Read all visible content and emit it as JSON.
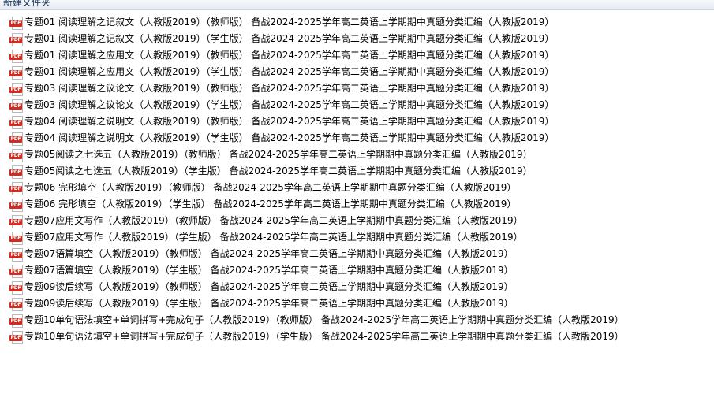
{
  "header": {
    "label": "新建文件夹"
  },
  "icon": {
    "type": "pdf-icon",
    "text": "PDF",
    "color": "#d42a20"
  },
  "files": [
    "专题01 阅读理解之记叙文（人教版2019）（教师版） 备战2024-2025学年高二英语上学期期中真题分类汇编（人教版2019）",
    "专题01 阅读理解之记叙文（人教版2019）（学生版） 备战2024-2025学年高二英语上学期期中真题分类汇编（人教版2019）",
    "专题01 阅读理解之应用文（人教版2019）（教师版） 备战2024-2025学年高二英语上学期期中真题分类汇编（人教版2019）",
    "专题01 阅读理解之应用文（人教版2019）（学生版） 备战2024-2025学年高二英语上学期期中真题分类汇编（人教版2019）",
    "专题03 阅读理解之议论文（人教版2019）（教师版） 备战2024-2025学年高二英语上学期期中真题分类汇编（人教版2019）",
    "专题03 阅读理解之议论文（人教版2019）（学生版） 备战2024-2025学年高二英语上学期期中真题分类汇编（人教版2019）",
    "专题04 阅读理解之说明文（人教版2019）（教师版） 备战2024-2025学年高二英语上学期期中真题分类汇编（人教版2019）",
    "专题04 阅读理解之说明文（人教版2019）（学生版） 备战2024-2025学年高二英语上学期期中真题分类汇编（人教版2019）",
    "专题05阅读之七选五（人教版2019）（教师版） 备战2024-2025学年高二英语上学期期中真题分类汇编（人教版2019）",
    "专题05阅读之七选五（人教版2019）（学生版） 备战2024-2025学年高二英语上学期期中真题分类汇编（人教版2019）",
    "专题06 完形填空（人教版2019）（教师版） 备战2024-2025学年高二英语上学期期中真题分类汇编（人教版2019）",
    "专题06 完形填空（人教版2019）（学生版） 备战2024-2025学年高二英语上学期期中真题分类汇编（人教版2019）",
    "专题07应用文写作（人教版2019）（教师版） 备战2024-2025学年高二英语上学期期中真题分类汇编（人教版2019）",
    "专题07应用文写作（人教版2019）（学生版） 备战2024-2025学年高二英语上学期期中真题分类汇编（人教版2019）",
    "专题07语篇填空（人教版2019）（教师版） 备战2024-2025学年高二英语上学期期中真题分类汇编（人教版2019）",
    "专题07语篇填空（人教版2019）（学生版） 备战2024-2025学年高二英语上学期期中真题分类汇编（人教版2019）",
    "专题09读后续写（人教版2019）（教师版） 备战2024-2025学年高二英语上学期期中真题分类汇编（人教版2019）",
    "专题09读后续写（人教版2019）（学生版） 备战2024-2025学年高二英语上学期期中真题分类汇编（人教版2019）",
    "专题10单句语法填空+单词拼写+完成句子（人教版2019）（教师版） 备战2024-2025学年高二英语上学期期中真题分类汇编（人教版2019）",
    "专题10单句语法填空+单词拼写+完成句子（人教版2019）（学生版） 备战2024-2025学年高二英语上学期期中真题分类汇编（人教版2019）"
  ]
}
